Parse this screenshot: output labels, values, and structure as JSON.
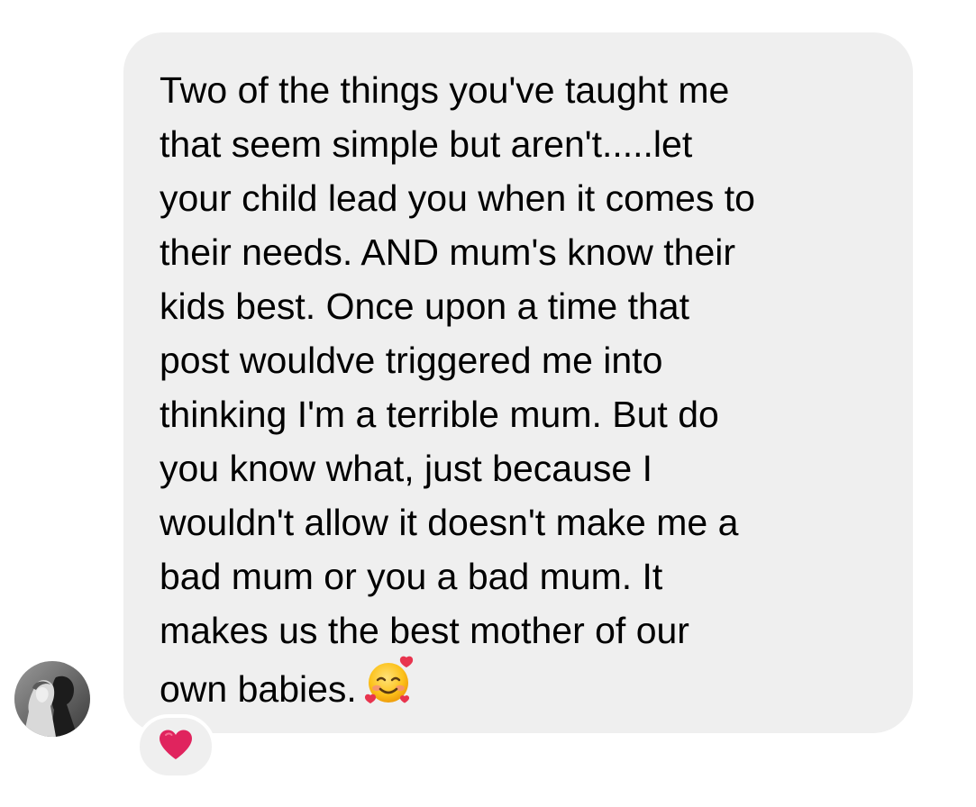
{
  "message": {
    "lines": [
      "Two of the things you've taught me",
      "that seem simple but aren't.....let",
      "your child lead you when it comes to",
      "their needs. AND mum's know their",
      "kids best. Once upon a time that",
      "post wouldve triggered me into",
      "thinking I'm a terrible mum. But do",
      "you know what, just because I",
      "wouldn't allow it doesn't make me a",
      "bad mum or you a bad mum. It",
      "makes us the best mother of our",
      "own babies."
    ],
    "trailing_emoji": "smiling-face-with-hearts-icon",
    "bubble_color": "#efefef",
    "text_color": "#000000"
  },
  "sender": {
    "avatar": "black-and-white-couple-photo"
  },
  "reaction": {
    "icon": "red-heart-icon",
    "color": "#e0245e"
  }
}
